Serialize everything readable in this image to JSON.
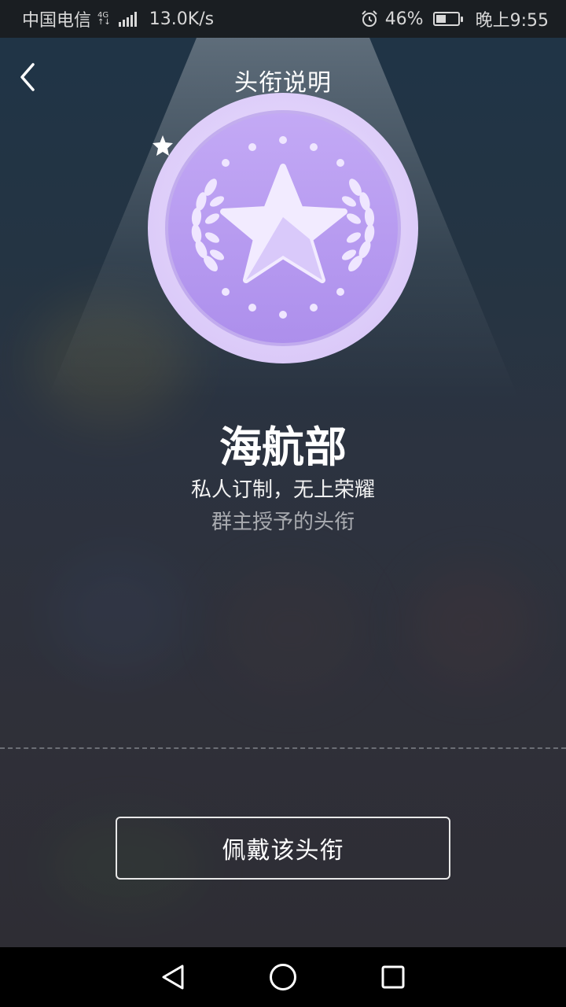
{
  "status_bar": {
    "carrier": "中国电信",
    "network_type_top": "4G",
    "network_type_bottom": "↑↓",
    "speed": "13.0K/s",
    "battery_percent": "46%",
    "battery_level": 0.46,
    "time": "晚上9:55"
  },
  "header": {
    "title": "头衔说明"
  },
  "badge": {
    "name": "海航部",
    "subtitle": "私人订制，无上荣耀",
    "description": "群主授予的头衔",
    "colors": {
      "outer": "#e6d9fb",
      "inner": "#b79cf0",
      "star": "#f1eafe"
    }
  },
  "actions": {
    "wear_button": "佩戴该头衔"
  },
  "nav_bar": {
    "back_icon": "triangle-back-icon",
    "home_icon": "circle-home-icon",
    "recents_icon": "square-recents-icon"
  }
}
